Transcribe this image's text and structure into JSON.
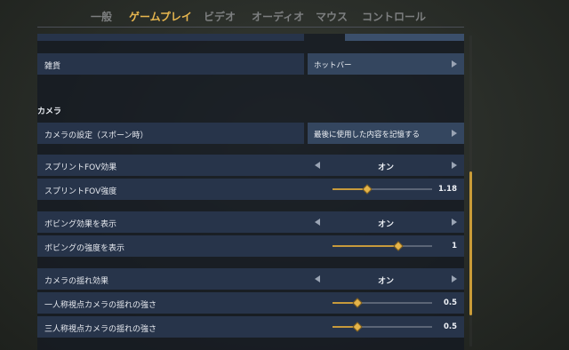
{
  "tabs": [
    {
      "label": "一般"
    },
    {
      "label": "ゲームプレイ",
      "active": true
    },
    {
      "label": "ビデオ"
    },
    {
      "label": "オーディオ"
    },
    {
      "label": "マウス"
    },
    {
      "label": "コントロール"
    }
  ],
  "rows": {
    "currency": {
      "label": "雑貨",
      "value": "ホットバー"
    },
    "camera_section": "カメラ",
    "camera_setting": {
      "label": "カメラの設定（スポーン時）",
      "value": "最後に使用した内容を記憶する"
    },
    "sprint_fov": {
      "label": "スプリントFOV効果",
      "value": "オン"
    },
    "sprint_fov_strength": {
      "label": "スプリントFOV強度",
      "value": "1.18",
      "fraction": 0.35
    },
    "bobbing": {
      "label": "ボビング効果を表示",
      "value": "オン"
    },
    "bobbing_strength": {
      "label": "ボビングの強度を表示",
      "value": "1",
      "fraction": 0.66
    },
    "camera_shake": {
      "label": "カメラの揺れ効果",
      "value": "オン"
    },
    "first_person_shake": {
      "label": "一人称視点カメラの揺れの強さ",
      "value": "0.5",
      "fraction": 0.25
    },
    "third_person_shake": {
      "label": "三人称視点カメラの揺れの強さ",
      "value": "0.5",
      "fraction": 0.25
    }
  },
  "colors": {
    "accent": "#e7b64f",
    "row": "#27344a",
    "button": "#34465f"
  }
}
